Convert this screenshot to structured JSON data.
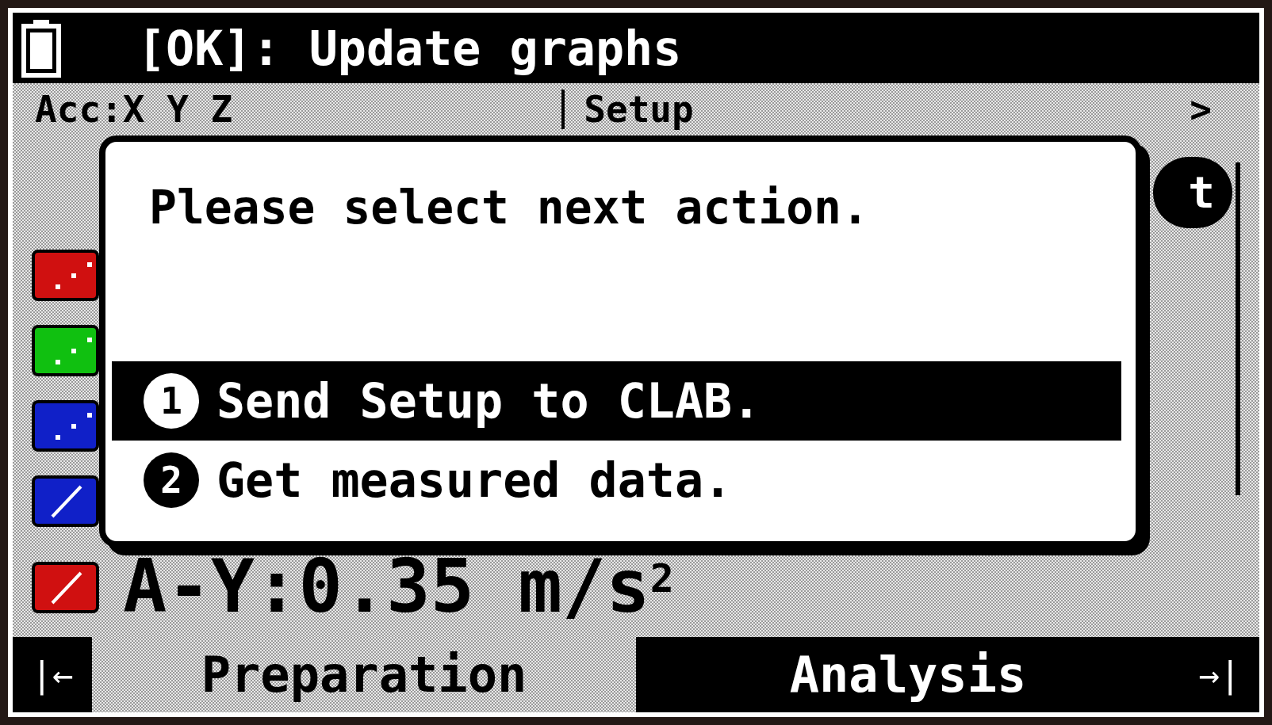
{
  "title_bar": {
    "text": "[OK]: Update graphs"
  },
  "header": {
    "sensor": "Acc:X Y Z",
    "tab": "Setup",
    "next": ">"
  },
  "side_button": {
    "label": "t"
  },
  "channels": [
    {
      "color": "#d01010",
      "kind": "dots"
    },
    {
      "color": "#10c010",
      "kind": "dots"
    },
    {
      "color": "#1020c8",
      "kind": "dots"
    },
    {
      "color": "#1020c8",
      "kind": "line"
    }
  ],
  "reading": {
    "color": "#d01010",
    "kind": "line",
    "text": "A-Y:0.35 m/s$^{2}$"
  },
  "dialog": {
    "message": "Please select next action.",
    "options": [
      {
        "number": "1",
        "label": "Send Setup to CLAB.",
        "selected": true
      },
      {
        "number": "2",
        "label": "Get measured data.",
        "selected": false
      }
    ]
  },
  "nav": {
    "first": "|←",
    "last": "→|"
  },
  "tabs": [
    {
      "label": "Preparation",
      "selected": true
    },
    {
      "label": "Analysis",
      "selected": false
    }
  ]
}
